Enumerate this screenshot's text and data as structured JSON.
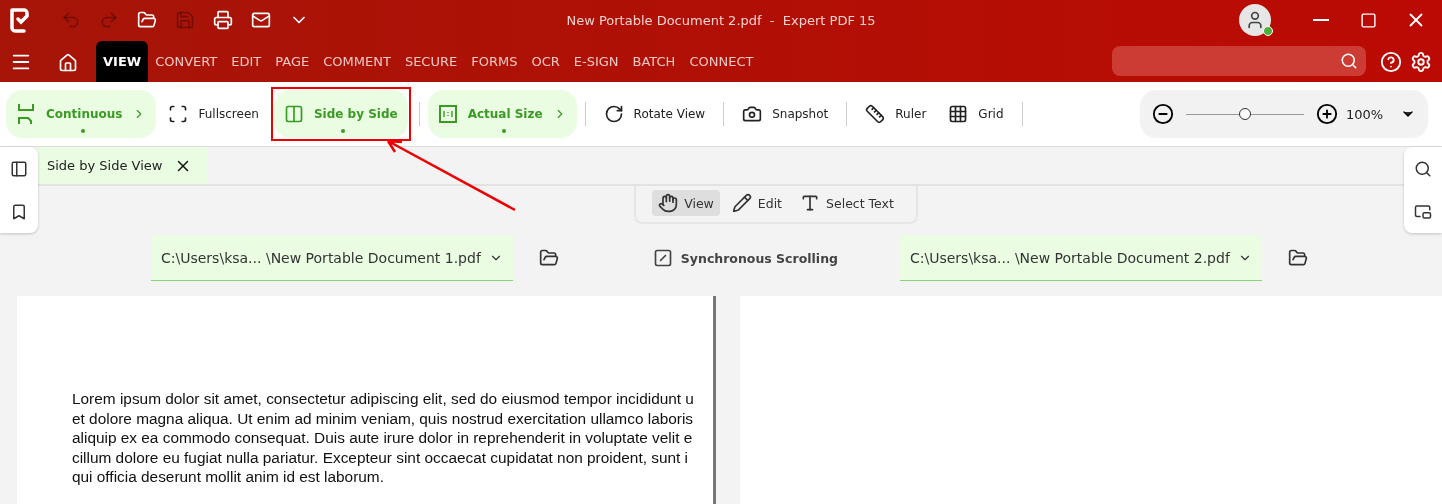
{
  "window": {
    "title": "New Portable Document 2.pdf  -  Expert PDF 15",
    "user_online": true
  },
  "menu": [
    {
      "label": "VIEW",
      "selected": true
    },
    {
      "label": "CONVERT",
      "selected": false
    },
    {
      "label": "EDIT",
      "selected": false
    },
    {
      "label": "PAGE",
      "selected": false
    },
    {
      "label": "COMMENT",
      "selected": false
    },
    {
      "label": "SECURE",
      "selected": false
    },
    {
      "label": "FORMS",
      "selected": false
    },
    {
      "label": "OCR",
      "selected": false
    },
    {
      "label": "E-SIGN",
      "selected": false
    },
    {
      "label": "BATCH",
      "selected": false
    },
    {
      "label": "CONNECT",
      "selected": false
    }
  ],
  "toolbar": [
    {
      "label": "Continuous",
      "selected": true,
      "has_menu": true
    },
    {
      "label": "Fullscreen",
      "selected": false,
      "has_menu": false
    },
    {
      "label": "Side by Side",
      "selected": true,
      "has_menu": false,
      "highlighted": true
    },
    {
      "label": "Actual Size",
      "selected": true,
      "has_menu": true
    },
    {
      "label": "Rotate View",
      "selected": false,
      "has_menu": false
    },
    {
      "label": "Snapshot",
      "selected": false,
      "has_menu": false
    },
    {
      "label": "Ruler",
      "selected": false,
      "has_menu": false
    },
    {
      "label": "Grid",
      "selected": false,
      "has_menu": false
    }
  ],
  "zoom": {
    "level": 0.5,
    "reading": "100%"
  },
  "document_tab": {
    "label": "Side by Side View"
  },
  "modes": [
    {
      "label": "View",
      "selected": true
    },
    {
      "label": "Edit",
      "selected": false
    },
    {
      "label": "Select Text",
      "selected": false
    }
  ],
  "files": [
    {
      "path": "C:\\Users\\ksa... \\New Portable Document 1.pdf"
    },
    {
      "path": "C:\\Users\\ksa... \\New Portable Document 2.pdf"
    }
  ],
  "sync": {
    "label": "Synchronous Scrolling"
  },
  "left_page": {
    "lines": [
      "Lorem ipsum dolor sit amet, consectetur adipiscing elit, sed do eiusmod tempor incididunt u",
      "et dolore magna aliqua. Ut enim ad minim veniam, quis nostrud exercitation ullamco laboris",
      "aliquip ex ea commodo consequat. Duis aute irure dolor in reprehenderit in voluptate velit e",
      "cillum dolore eu fugiat nulla pariatur. Excepteur sint occaecat cupidatat non proident, sunt i",
      "qui officia deserunt mollit anim id est laborum."
    ]
  }
}
